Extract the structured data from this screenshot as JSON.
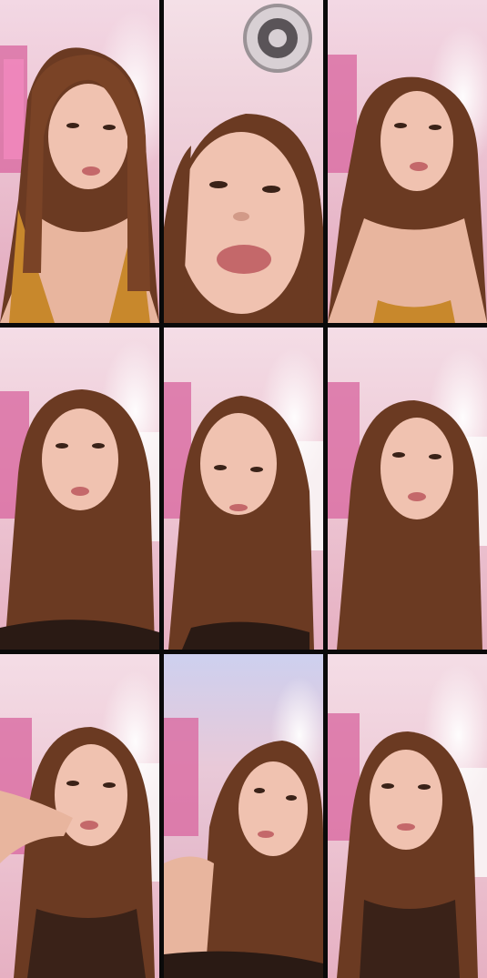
{
  "frames": [
    {
      "scene": "selfie-frame",
      "position": "top-left"
    },
    {
      "scene": "selfie-frame-closeup-ceiling-vent",
      "position": "top-center"
    },
    {
      "scene": "selfie-frame",
      "position": "top-right"
    },
    {
      "scene": "selfie-frame",
      "position": "middle-left"
    },
    {
      "scene": "selfie-frame",
      "position": "middle-center"
    },
    {
      "scene": "selfie-frame",
      "position": "middle-right"
    },
    {
      "scene": "selfie-frame-hand-gesture",
      "position": "bottom-left"
    },
    {
      "scene": "selfie-frame-tilted",
      "position": "bottom-center"
    },
    {
      "scene": "selfie-frame",
      "position": "bottom-right"
    }
  ],
  "colors": {
    "wall_pink": "#e9b7c6",
    "ceiling": "#f2d9e3",
    "hair": "#6b3a22",
    "skin": "#e8b59e",
    "top": "#c8882c",
    "gutter": "#0a0a0a"
  }
}
